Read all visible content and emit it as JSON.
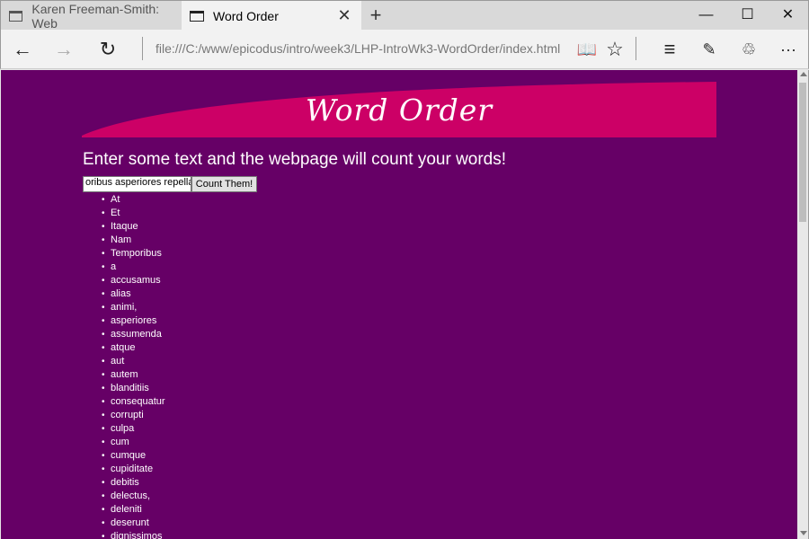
{
  "browser": {
    "tabs": [
      {
        "title": "Karen Freeman-Smith: Web"
      },
      {
        "title": "Word Order",
        "close": "✕"
      }
    ],
    "new_tab": "+",
    "window_controls": {
      "minimize": "—",
      "maximize": "☐",
      "close": "✕"
    },
    "nav": {
      "back": "←",
      "forward": "→",
      "refresh": "↻"
    },
    "address": "file:///C:/www/epicodus/intro/week3/LHP-IntroWk3-WordOrder/index.html",
    "tools": {
      "reading_view": "📖",
      "favorite": "☆",
      "hub": "≡",
      "note": "✎",
      "share": "♲",
      "more": "···"
    },
    "scrollbar": {
      "position_fraction": 0.0
    }
  },
  "page": {
    "colors": {
      "background": "#660066",
      "banner": "#cc0066"
    },
    "banner_title": "Word Order",
    "intro": "Enter some text and the webpage will count your words!",
    "input_value": "oribus asperiores repellat",
    "button_label": "Count Them!",
    "words": [
      "At",
      "Et",
      "Itaque",
      "Nam",
      "Temporibus",
      "a",
      "accusamus",
      "alias",
      "animi,",
      "asperiores",
      "assumenda",
      "atque",
      "aut",
      "autem",
      "blanditiis",
      "consequatur",
      "corrupti",
      "culpa",
      "cum",
      "cumque",
      "cupiditate",
      "debitis",
      "delectus,",
      "deleniti",
      "deserunt",
      "dignissimos"
    ]
  }
}
